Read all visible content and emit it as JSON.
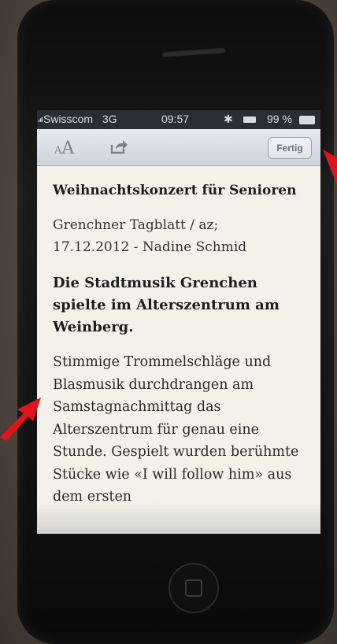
{
  "status_bar": {
    "carrier": "Swisscom",
    "network": "3G",
    "time": "09:57",
    "battery": "99 %"
  },
  "toolbar": {
    "font_control_small": "A",
    "font_control_large": "A",
    "done_label": "Fertig"
  },
  "article": {
    "title": "Weihnachtskonzert für Senioren",
    "meta_line1": "Grenchner Tagblatt / az;",
    "meta_line2": "17.12.2012 - Nadine Schmid",
    "lead": "Die Stadtmusik Grenchen spielte im Alterszentrum am Weinberg.",
    "body": "Stimmige Trommelschläge und Blasmusik durchdrangen am Samstagnachmittag das Alterszentrum für genau eine Stunde. Gespielt wurden berühmte Stücke wie «I will follow him» aus dem ersten"
  },
  "colors": {
    "annotation_arrow": "#e0141a",
    "screen_background": "#f4f1ea",
    "toolbar_background": "#d8dce2"
  },
  "icons": [
    "signal-icon",
    "bluetooth-icon",
    "lock-icon",
    "battery-icon",
    "share-icon",
    "home-button-icon"
  ]
}
